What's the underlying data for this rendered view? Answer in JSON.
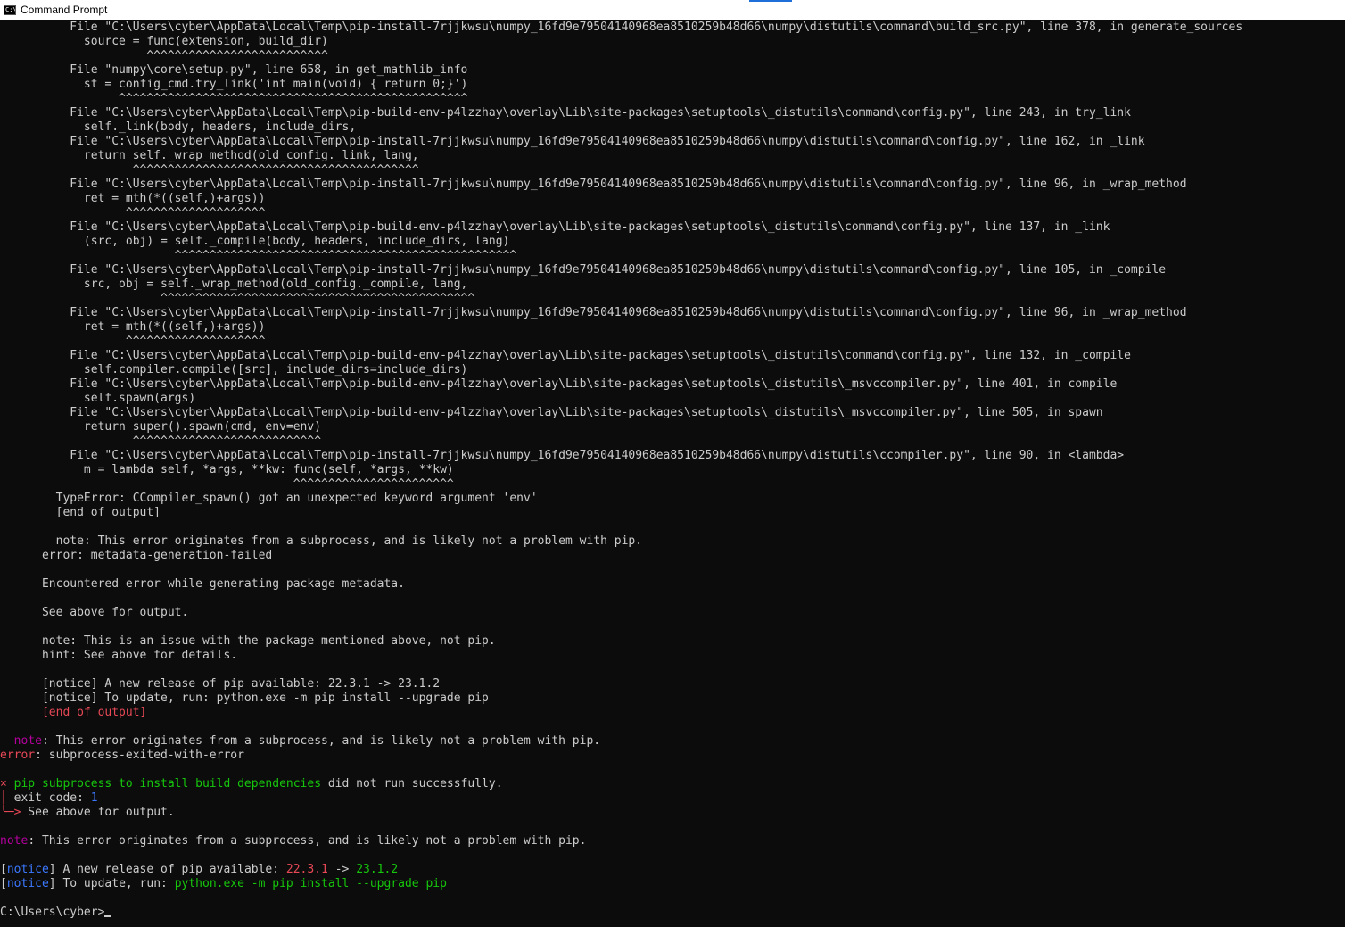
{
  "window": {
    "title": "Command Prompt",
    "icon": "cmd-icon"
  },
  "colors": {
    "default": "#cccccc",
    "red": "#e74856",
    "magenta": "#b4009e",
    "green": "#16c60c",
    "blue": "#3b78ff",
    "background": "#0c0c0c"
  },
  "lines": [
    {
      "segs": [
        {
          "t": "          File \"C:\\Users\\cyber\\AppData\\Local\\Temp\\pip-install-7rjjkwsu\\numpy_16fd9e79504140968ea8510259b48d66\\numpy\\distutils\\command\\build_src.py\", line 378, in generate_sources"
        }
      ]
    },
    {
      "segs": [
        {
          "t": "            source = func(extension, build_dir)"
        }
      ]
    },
    {
      "segs": [
        {
          "t": "                     ^^^^^^^^^^^^^^^^^^^^^^^^^^"
        }
      ]
    },
    {
      "segs": [
        {
          "t": "          File \"numpy\\core\\setup.py\", line 658, in get_mathlib_info"
        }
      ]
    },
    {
      "segs": [
        {
          "t": "            st = config_cmd.try_link('int main(void) { return 0;}')"
        }
      ]
    },
    {
      "segs": [
        {
          "t": "                 ^^^^^^^^^^^^^^^^^^^^^^^^^^^^^^^^^^^^^^^^^^^^^^^^^^"
        }
      ]
    },
    {
      "segs": [
        {
          "t": "          File \"C:\\Users\\cyber\\AppData\\Local\\Temp\\pip-build-env-p4lzzhay\\overlay\\Lib\\site-packages\\setuptools\\_distutils\\command\\config.py\", line 243, in try_link"
        }
      ]
    },
    {
      "segs": [
        {
          "t": "            self._link(body, headers, include_dirs,"
        }
      ]
    },
    {
      "segs": [
        {
          "t": "          File \"C:\\Users\\cyber\\AppData\\Local\\Temp\\pip-install-7rjjkwsu\\numpy_16fd9e79504140968ea8510259b48d66\\numpy\\distutils\\command\\config.py\", line 162, in _link"
        }
      ]
    },
    {
      "segs": [
        {
          "t": "            return self._wrap_method(old_config._link, lang,"
        }
      ]
    },
    {
      "segs": [
        {
          "t": "                   ^^^^^^^^^^^^^^^^^^^^^^^^^^^^^^^^^^^^^^^^^"
        }
      ]
    },
    {
      "segs": [
        {
          "t": "          File \"C:\\Users\\cyber\\AppData\\Local\\Temp\\pip-install-7rjjkwsu\\numpy_16fd9e79504140968ea8510259b48d66\\numpy\\distutils\\command\\config.py\", line 96, in _wrap_method"
        }
      ]
    },
    {
      "segs": [
        {
          "t": "            ret = mth(*((self,)+args))"
        }
      ]
    },
    {
      "segs": [
        {
          "t": "                  ^^^^^^^^^^^^^^^^^^^^"
        }
      ]
    },
    {
      "segs": [
        {
          "t": "          File \"C:\\Users\\cyber\\AppData\\Local\\Temp\\pip-build-env-p4lzzhay\\overlay\\Lib\\site-packages\\setuptools\\_distutils\\command\\config.py\", line 137, in _link"
        }
      ]
    },
    {
      "segs": [
        {
          "t": "            (src, obj) = self._compile(body, headers, include_dirs, lang)"
        }
      ]
    },
    {
      "segs": [
        {
          "t": "                         ^^^^^^^^^^^^^^^^^^^^^^^^^^^^^^^^^^^^^^^^^^^^^^^^^"
        }
      ]
    },
    {
      "segs": [
        {
          "t": "          File \"C:\\Users\\cyber\\AppData\\Local\\Temp\\pip-install-7rjjkwsu\\numpy_16fd9e79504140968ea8510259b48d66\\numpy\\distutils\\command\\config.py\", line 105, in _compile"
        }
      ]
    },
    {
      "segs": [
        {
          "t": "            src, obj = self._wrap_method(old_config._compile, lang,"
        }
      ]
    },
    {
      "segs": [
        {
          "t": "                       ^^^^^^^^^^^^^^^^^^^^^^^^^^^^^^^^^^^^^^^^^^^^^"
        }
      ]
    },
    {
      "segs": [
        {
          "t": "          File \"C:\\Users\\cyber\\AppData\\Local\\Temp\\pip-install-7rjjkwsu\\numpy_16fd9e79504140968ea8510259b48d66\\numpy\\distutils\\command\\config.py\", line 96, in _wrap_method"
        }
      ]
    },
    {
      "segs": [
        {
          "t": "            ret = mth(*((self,)+args))"
        }
      ]
    },
    {
      "segs": [
        {
          "t": "                  ^^^^^^^^^^^^^^^^^^^^"
        }
      ]
    },
    {
      "segs": [
        {
          "t": "          File \"C:\\Users\\cyber\\AppData\\Local\\Temp\\pip-build-env-p4lzzhay\\overlay\\Lib\\site-packages\\setuptools\\_distutils\\command\\config.py\", line 132, in _compile"
        }
      ]
    },
    {
      "segs": [
        {
          "t": "            self.compiler.compile([src], include_dirs=include_dirs)"
        }
      ]
    },
    {
      "segs": [
        {
          "t": "          File \"C:\\Users\\cyber\\AppData\\Local\\Temp\\pip-build-env-p4lzzhay\\overlay\\Lib\\site-packages\\setuptools\\_distutils\\_msvccompiler.py\", line 401, in compile"
        }
      ]
    },
    {
      "segs": [
        {
          "t": "            self.spawn(args)"
        }
      ]
    },
    {
      "segs": [
        {
          "t": "          File \"C:\\Users\\cyber\\AppData\\Local\\Temp\\pip-build-env-p4lzzhay\\overlay\\Lib\\site-packages\\setuptools\\_distutils\\_msvccompiler.py\", line 505, in spawn"
        }
      ]
    },
    {
      "segs": [
        {
          "t": "            return super().spawn(cmd, env=env)"
        }
      ]
    },
    {
      "segs": [
        {
          "t": "                   ^^^^^^^^^^^^^^^^^^^^^^^^^^^"
        }
      ]
    },
    {
      "segs": [
        {
          "t": "          File \"C:\\Users\\cyber\\AppData\\Local\\Temp\\pip-install-7rjjkwsu\\numpy_16fd9e79504140968ea8510259b48d66\\numpy\\distutils\\ccompiler.py\", line 90, in <lambda>"
        }
      ]
    },
    {
      "segs": [
        {
          "t": "            m = lambda self, *args, **kw: func(self, *args, **kw)"
        }
      ]
    },
    {
      "segs": [
        {
          "t": "                                          ^^^^^^^^^^^^^^^^^^^^^^^"
        }
      ]
    },
    {
      "segs": [
        {
          "t": "        TypeError: CCompiler_spawn() got an unexpected keyword argument 'env'"
        }
      ]
    },
    {
      "segs": [
        {
          "t": "        [end of output]"
        }
      ]
    },
    {
      "segs": [
        {
          "t": ""
        }
      ]
    },
    {
      "segs": [
        {
          "t": "        note: This error originates from a subprocess, and is likely not a problem with pip."
        }
      ]
    },
    {
      "segs": [
        {
          "t": "      error: metadata-generation-failed"
        }
      ]
    },
    {
      "segs": [
        {
          "t": ""
        }
      ]
    },
    {
      "segs": [
        {
          "t": "      Encountered error while generating package metadata."
        }
      ]
    },
    {
      "segs": [
        {
          "t": ""
        }
      ]
    },
    {
      "segs": [
        {
          "t": "      See above for output."
        }
      ]
    },
    {
      "segs": [
        {
          "t": ""
        }
      ]
    },
    {
      "segs": [
        {
          "t": "      note: This is an issue with the package mentioned above, not pip."
        }
      ]
    },
    {
      "segs": [
        {
          "t": "      hint: See above for details."
        }
      ]
    },
    {
      "segs": [
        {
          "t": ""
        }
      ]
    },
    {
      "segs": [
        {
          "t": "      [notice] A new release of pip available: 22.3.1 -> 23.1.2"
        }
      ]
    },
    {
      "segs": [
        {
          "t": "      [notice] To update, run: python.exe -m pip install --upgrade pip"
        }
      ]
    },
    {
      "segs": [
        {
          "t": "      [end of output]",
          "c": "red"
        }
      ]
    },
    {
      "segs": [
        {
          "t": ""
        }
      ]
    },
    {
      "segs": [
        {
          "t": "  "
        },
        {
          "t": "note",
          "c": "magenta"
        },
        {
          "t": ": This error originates from a subprocess, and is likely not a problem with pip."
        }
      ]
    },
    {
      "segs": [
        {
          "t": "error",
          "c": "red"
        },
        {
          "t": ": subprocess-exited-with-error"
        }
      ]
    },
    {
      "segs": [
        {
          "t": ""
        }
      ]
    },
    {
      "segs": [
        {
          "t": "× ",
          "c": "red"
        },
        {
          "t": "pip subprocess to install build dependencies",
          "c": "green"
        },
        {
          "t": " did not run successfully."
        }
      ]
    },
    {
      "segs": [
        {
          "t": "│",
          "c": "red"
        },
        {
          "t": " exit code: "
        },
        {
          "t": "1",
          "c": "blue"
        }
      ]
    },
    {
      "segs": [
        {
          "t": "╰─>",
          "c": "red"
        },
        {
          "t": " See above for output."
        }
      ]
    },
    {
      "segs": [
        {
          "t": ""
        }
      ]
    },
    {
      "segs": [
        {
          "t": "note",
          "c": "magenta"
        },
        {
          "t": ": This error originates from a subprocess, and is likely not a problem with pip."
        }
      ]
    },
    {
      "segs": [
        {
          "t": ""
        }
      ]
    },
    {
      "segs": [
        {
          "t": "["
        },
        {
          "t": "notice",
          "c": "blue"
        },
        {
          "t": "] A new release of pip available: "
        },
        {
          "t": "22.3.1",
          "c": "red"
        },
        {
          "t": " -> "
        },
        {
          "t": "23.1.2",
          "c": "green"
        }
      ]
    },
    {
      "segs": [
        {
          "t": "["
        },
        {
          "t": "notice",
          "c": "blue"
        },
        {
          "t": "] To update, run: "
        },
        {
          "t": "python.exe -m pip install --upgrade pip",
          "c": "green"
        }
      ]
    },
    {
      "segs": [
        {
          "t": ""
        }
      ]
    },
    {
      "segs": [
        {
          "t": "C:\\Users\\cyber>"
        }
      ],
      "cursor": true
    }
  ]
}
